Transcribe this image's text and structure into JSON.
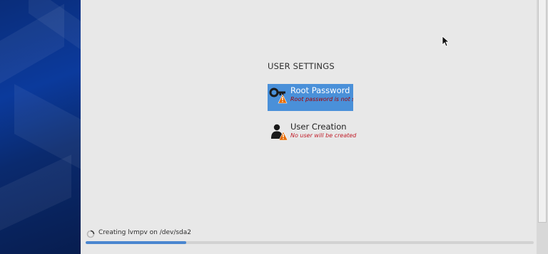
{
  "sections": {
    "user_settings_title": "USER SETTINGS"
  },
  "spokes": [
    {
      "title": "Root Password",
      "status": "Root password is not set",
      "icon": "key-warning-icon",
      "selected": true
    },
    {
      "title": "User Creation",
      "status": "No user will be created",
      "icon": "user-warning-icon",
      "selected": false
    }
  ],
  "progress": {
    "label": "Creating lvmpv on /dev/sda2",
    "fraction": 0.225
  },
  "colors": {
    "accent": "#4a90d9",
    "warning": "#e66a00",
    "error_text": "#c01c28",
    "sidebar": "#0b3a9c"
  }
}
